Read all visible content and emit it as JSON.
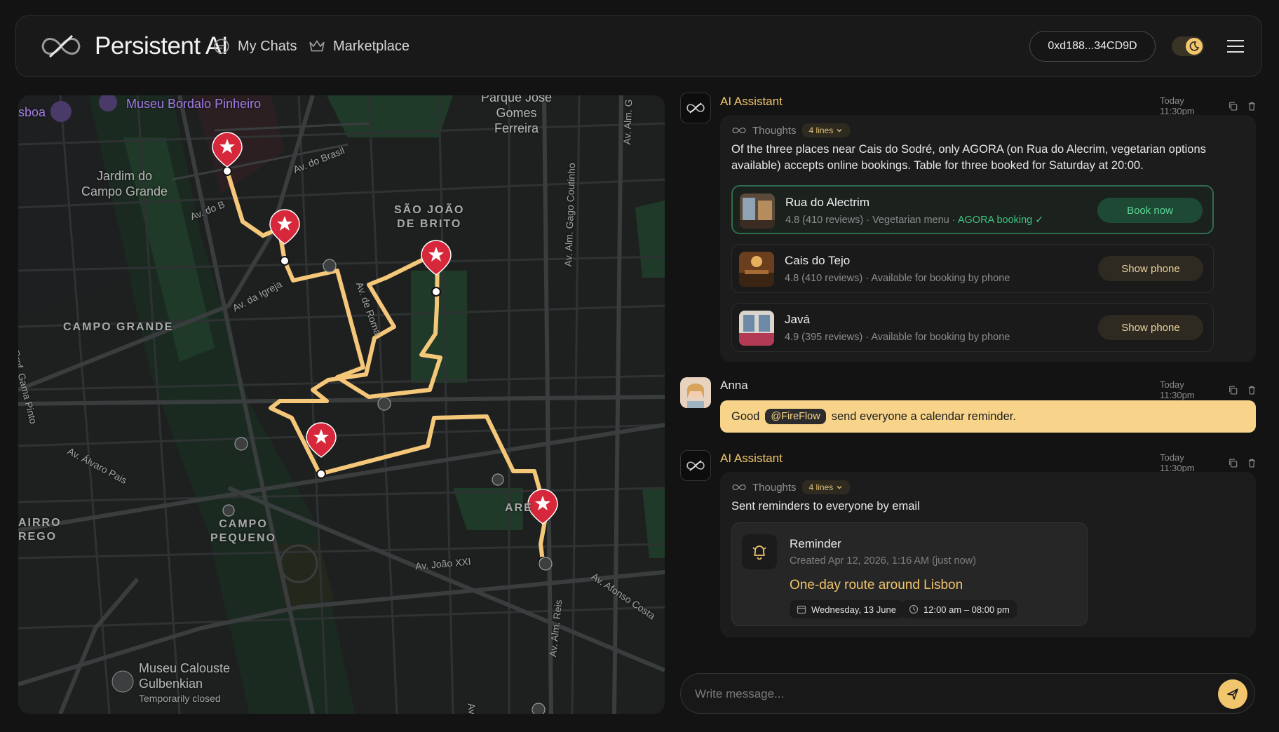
{
  "header": {
    "brand_name": "Persistent AI",
    "nav": [
      {
        "label": "My Chats",
        "icon": "chat-bubble-icon"
      },
      {
        "label": "Marketplace",
        "icon": "crown-icon"
      }
    ],
    "wallet_address": "0xd188...34CD9D",
    "theme": "dark"
  },
  "map": {
    "labels": {
      "museu_bordalo": "Museu Bordalo Pinheiro",
      "jardim": "Jardim do\nCampo Grande",
      "parque": "Parque José\nGomes\nFerreira",
      "sao_joao": "SÃO JOÃO\nDE BRITO",
      "campo_grande": "CAMPO GRANDE",
      "campo_pequeno": "CAMPO\nPEQUENO",
      "bairro": "AIRRO\nREGO",
      "areeiro": "ARE",
      "lisboa": "sboa",
      "museu_gulbenkian": "Museu Calouste\nGulbenkian",
      "gulbenkian_status": "Temporarily closed",
      "av_do_brasil": "Av. do Brasil",
      "av_do_b": "Av. do B",
      "av_da_igreja": "Av. da Igreja",
      "av_de_roma": "Av. de Roma",
      "av_gago": "Av. Alm. Gago Coutinho",
      "av_alvaro": "Av. Álvaro Pais",
      "av_joao": "Av. João XXI",
      "av_afonso": "Av. Afonso Costa",
      "av_alm_reis": "Av. Alm. Reis",
      "av_manuel": "Av. Manuel",
      "av_alm_top": "Av. Alm. G",
      "gama_pinto": "Prof. Gama Pinto"
    },
    "route_stops": 5
  },
  "chat": {
    "messages": [
      {
        "author": "AI Assistant",
        "time": "Today 11:30pm",
        "thoughts_label": "Thoughts",
        "thoughts_lines": "4 lines",
        "text": "Of the three places near Cais do Sodré, only AGORA (on Rua do Alecrim, vegetarian options available) accepts online bookings. Table for three booked for Saturday at 20:00.",
        "places": [
          {
            "name": "Rua do Alectrim",
            "rating": "4.8 (410 reviews)",
            "detail": "Vegetarian menu",
            "extra": "AGORA booking ✓",
            "button": "Book now"
          },
          {
            "name": "Cais do Tejo",
            "rating": "4.8 (410 reviews)",
            "detail": "Available for booking by phone",
            "button": "Show phone"
          },
          {
            "name": "Javá",
            "rating": "4.9 (395 reviews)",
            "detail": "Available for booking by phone",
            "button": "Show phone"
          }
        ]
      },
      {
        "author": "Anna",
        "time": "Today 11:30pm",
        "text_before": "Good",
        "mention": "@FireFlow",
        "text_after": "send everyone a calendar reminder."
      },
      {
        "author": "AI Assistant",
        "time": "Today 11:30pm",
        "thoughts_label": "Thoughts",
        "thoughts_lines": "4 lines",
        "text": "Sent reminders to everyone by email",
        "reminder": {
          "title": "Reminder",
          "created": "Created Apr 12, 2026, 1:16 AM (just now)",
          "event": "One-day route around Lisbon",
          "date": "Wednesday, 13 June",
          "time": "12:00 am – 08:00 pm"
        }
      }
    ],
    "composer_placeholder": "Write message..."
  },
  "colors": {
    "accent": "#f2c66c",
    "background": "#131313",
    "panel": "#1c1c1c",
    "success": "#3ec47e",
    "route": "#f5c879",
    "pin": "#d6283a"
  }
}
